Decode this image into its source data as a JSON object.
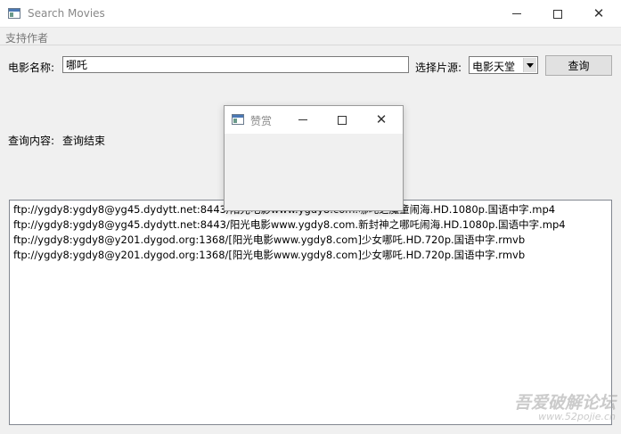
{
  "window": {
    "title": "Search Movies"
  },
  "menu": {
    "items": [
      "支持作者"
    ]
  },
  "search": {
    "movie_label": "电影名称:",
    "movie_value": "哪吒",
    "source_label": "选择片源:",
    "source_selected": "电影天堂",
    "query_button": "查询"
  },
  "status": {
    "label": "查询内容:",
    "value": "查询结束"
  },
  "results": [
    "ftp://ygdy8:ygdy8@yg45.dydytt.net:8443/阳光电影www.ygdy8.com.哪吒之魔童闹海.HD.1080p.国语中字.mp4",
    "ftp://ygdy8:ygdy8@yg45.dydytt.net:8443/阳光电影www.ygdy8.com.新封神之哪吒闹海.HD.1080p.国语中字.mp4",
    "ftp://ygdy8:ygdy8@y201.dygod.org:1368/[阳光电影www.ygdy8.com]少女哪吒.HD.720p.国语中字.rmvb",
    "ftp://ygdy8:ygdy8@y201.dygod.org:1368/[阳光电影www.ygdy8.com]少女哪吒.HD.720p.国语中字.rmvb"
  ],
  "dialog": {
    "title": "赞赏"
  },
  "watermark": {
    "line1": "吾爱破解论坛",
    "line2": "www.52pojie.cn"
  }
}
